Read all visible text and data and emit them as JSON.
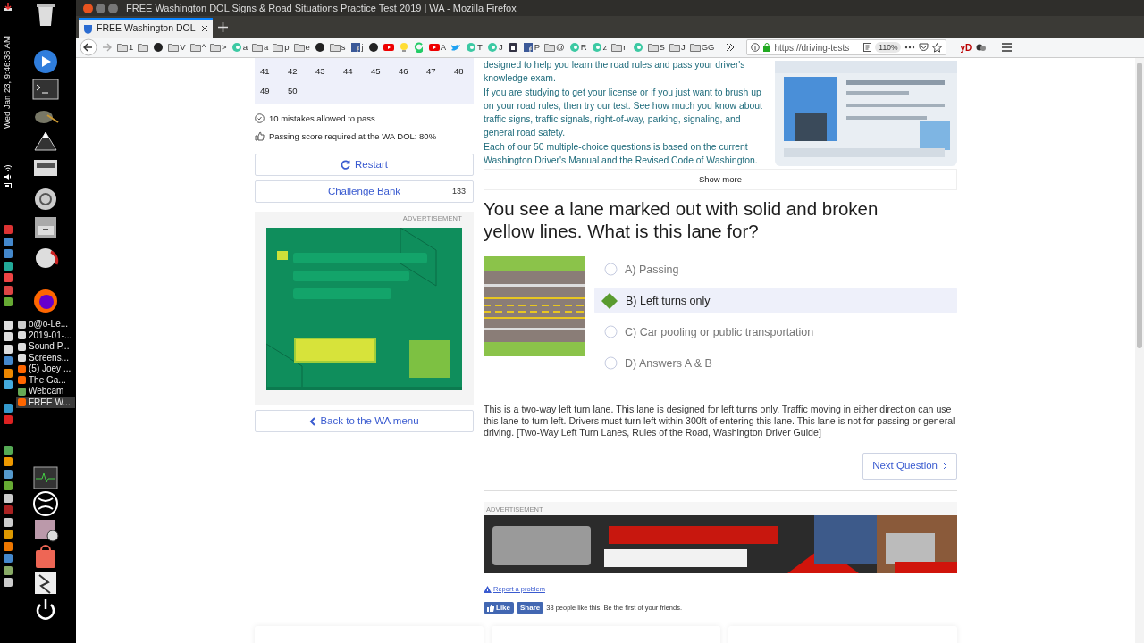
{
  "window": {
    "title": "FREE Washington DOL Signs & Road Situations Practice Test 2019 | WA - Mozilla Firefox"
  },
  "desktop_panel": {
    "clock": "Wed Jan 23, 9:46:36 AM",
    "windows": [
      {
        "label": "o@o-Le...",
        "selected": false
      },
      {
        "label": "2019-01-...",
        "selected": false
      },
      {
        "label": "Sound P...",
        "selected": false
      },
      {
        "label": "Screens...",
        "selected": false
      },
      {
        "label": "(5) Joey ...",
        "selected": false
      },
      {
        "label": "The Ga...",
        "selected": false
      },
      {
        "label": "Webcam",
        "selected": false
      },
      {
        "label": "FREE W...",
        "selected": true
      }
    ]
  },
  "browser": {
    "tab": {
      "title": "FREE Washington DOL",
      "selected": true
    },
    "bookmarks": [
      {
        "kind": "folder",
        "label": "1"
      },
      {
        "kind": "folder"
      },
      {
        "kind": "dark"
      },
      {
        "kind": "folder",
        "label": "V"
      },
      {
        "kind": "folder",
        "label": "^"
      },
      {
        "kind": "folder",
        "label": ">"
      },
      {
        "kind": "green",
        "label": "a"
      },
      {
        "kind": "folder",
        "label": "a"
      },
      {
        "kind": "folder",
        "label": "p"
      },
      {
        "kind": "folder",
        "label": "e"
      },
      {
        "kind": "dark"
      },
      {
        "kind": "folder",
        "label": "s"
      },
      {
        "kind": "facebook",
        "label": "j"
      },
      {
        "kind": "dark"
      },
      {
        "kind": "youtube"
      },
      {
        "kind": "bulb"
      },
      {
        "kind": "g"
      },
      {
        "kind": "youtube",
        "label": "A"
      },
      {
        "kind": "twitter"
      },
      {
        "kind": "green",
        "label": "T"
      },
      {
        "kind": "green",
        "label": "J"
      },
      {
        "kind": "lock"
      },
      {
        "kind": "facebook",
        "label": "P"
      },
      {
        "kind": "folder",
        "label": "@"
      },
      {
        "kind": "green",
        "label": "R"
      },
      {
        "kind": "green",
        "label": "z"
      },
      {
        "kind": "folder",
        "label": "n"
      },
      {
        "kind": "green"
      },
      {
        "kind": "folder",
        "label": "S"
      },
      {
        "kind": "folder",
        "label": "J"
      },
      {
        "kind": "folder",
        "label": "GG"
      }
    ],
    "url": "https://driving-tests",
    "zoom": "110%",
    "extension_label": "yD"
  },
  "sidebar": {
    "question_numbers": [
      "41",
      "42",
      "43",
      "44",
      "45",
      "46",
      "47",
      "48",
      "49",
      "50"
    ],
    "info": [
      {
        "kind": "mistakes",
        "text": "10 mistakes allowed to pass"
      },
      {
        "kind": "score",
        "text": "Passing score required at the WA DOL: 80%"
      }
    ],
    "restart": "Restart",
    "challenge_bank": {
      "label": "Challenge Bank",
      "count": "133"
    },
    "ad_label": "ADVERTISEMENT",
    "back": "Back to the WA menu"
  },
  "intro": {
    "paragraphs": [
      "designed to help you learn the road rules and pass your driver's knowledge exam.",
      "If you are studying to get your license or if you just want to brush up on your road rules, then try our test. See how much you know about traffic signs, traffic signals, right-of-way, parking, signaling, and general road safety.",
      "Each of our 50 multiple-choice questions is based on the current Washington Driver's Manual and the Revised Code of Washington."
    ],
    "show_more": "Show more"
  },
  "question": {
    "text": "You see a lane marked out with solid and broken yellow lines. What is this lane for?",
    "options": [
      {
        "text": "A) Passing",
        "selected": false
      },
      {
        "text": "B) Left turns only",
        "selected": true
      },
      {
        "text": "C) Car pooling or public transportation",
        "selected": false
      },
      {
        "text": "D) Answers A & B",
        "selected": false
      }
    ],
    "explanation": "This is a two-way left turn lane. This lane is designed for left turns only. Traffic moving in either direction can use this lane to turn left. Drivers must turn left within 300ft of entering this lane. This lane is not for passing or general driving. [Two-Way Left Turn Lanes, Rules of the Road, Washington Driver Guide]",
    "next": "Next Question"
  },
  "footer": {
    "ad_label": "ADVERTISEMENT",
    "report": "Report a problem",
    "like": "Like",
    "share": "Share",
    "social_text": "38 people like this. Be the first of your friends."
  }
}
